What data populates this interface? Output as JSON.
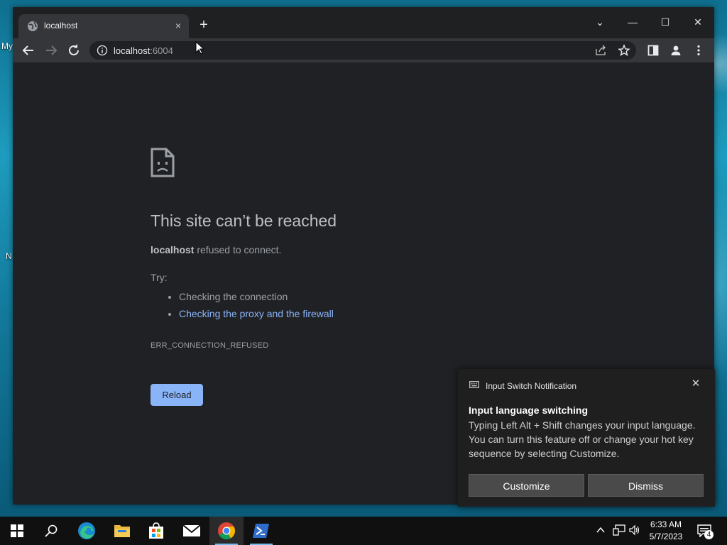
{
  "desktop": {
    "icon_labels": [
      "My",
      "N"
    ]
  },
  "browser": {
    "tab": {
      "title": "localhost",
      "close_glyph": "×"
    },
    "new_tab_glyph": "+",
    "window_controls": {
      "dropdown": "⌄",
      "minimize": "—",
      "maximize": "☐",
      "close": "✕"
    },
    "address": {
      "host": "localhost",
      "port": ":6004"
    }
  },
  "error_page": {
    "title": "This site can’t be reached",
    "host": "localhost",
    "desc_suffix": " refused to connect.",
    "try_label": "Try:",
    "suggestions": [
      "Checking the connection",
      "Checking the proxy and the firewall"
    ],
    "error_code": "ERR_CONNECTION_REFUSED",
    "reload_label": "Reload"
  },
  "notification": {
    "app_name": "Input Switch Notification",
    "title": "Input language switching",
    "message": "Typing Left Alt + Shift changes your input language. You can turn this feature off or change your hot key sequence by selecting Customize.",
    "customize_label": "Customize",
    "dismiss_label": "Dismiss",
    "close_glyph": "✕"
  },
  "taskbar": {
    "time": "6:33 AM",
    "date": "5/7/2023",
    "notification_count": "4"
  },
  "colors": {
    "accent": "#8ab4f8",
    "page_bg": "#202124",
    "taskbar": "#101010"
  }
}
